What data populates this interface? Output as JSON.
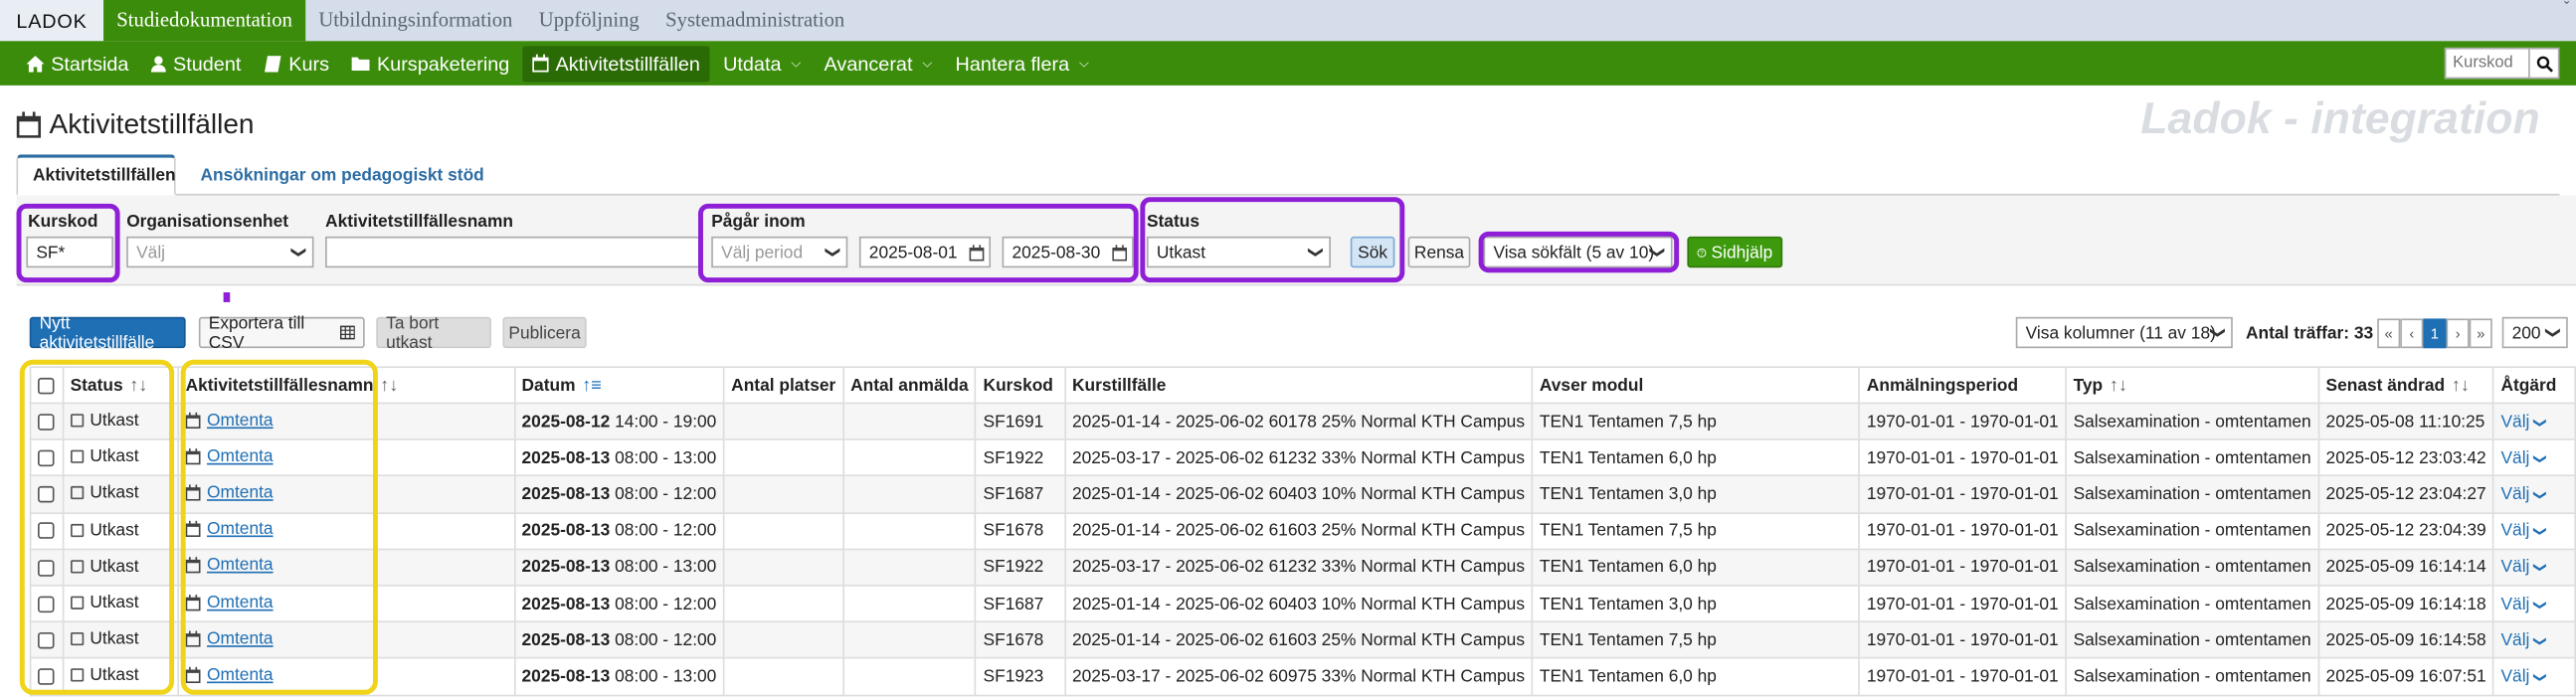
{
  "top": {
    "logo": "LADOK",
    "tabs": [
      "Studiedokumentation",
      "Utbildningsinformation",
      "Uppföljning",
      "Systemadministration"
    ],
    "corner": "ˇ"
  },
  "nav": {
    "items": [
      {
        "label": "Startsida",
        "icon": "home-icon"
      },
      {
        "label": "Student",
        "icon": "user-icon"
      },
      {
        "label": "Kurs",
        "icon": "book-icon"
      },
      {
        "label": "Kurspaketering",
        "icon": "folder-icon"
      },
      {
        "label": "Aktivitetstillfällen",
        "icon": "calendar-icon"
      },
      {
        "label": "Utdata",
        "dropdown": true
      },
      {
        "label": "Avancerat",
        "dropdown": true
      },
      {
        "label": "Hantera flera",
        "dropdown": true
      }
    ],
    "search_placeholder": "Kurskod"
  },
  "page": {
    "title": "Aktivitetstillfällen",
    "watermark": "Ladok - integration"
  },
  "tabs": [
    "Aktivitetstillfällen",
    "Ansökningar om pedagogiskt stöd"
  ],
  "filters": {
    "kurskod_label": "Kurskod",
    "kurskod_value": "SF*",
    "org_label": "Organisationsenhet",
    "org_placeholder": "Välj",
    "name_label": "Aktivitetstillfällesnamn",
    "name_value": "",
    "period_label": "Pågår inom",
    "period_placeholder": "Välj period",
    "date_from": "2025-08-01",
    "date_to": "2025-08-30",
    "status_label": "Status",
    "status_value": "Utkast",
    "search_button": "Sök",
    "clear_button": "Rensa",
    "show_fields": "Visa sökfält (5 av 10)",
    "help_button": "Sidhjälp"
  },
  "toolbar": {
    "new_button": "Nytt aktivitetstillfälle",
    "export_button": "Exportera till CSV",
    "delete_button": "Ta bort utkast",
    "publish_button": "Publicera",
    "columns_select": "Visa kolumner (11 av 18)",
    "hits_label": "Antal träffar: 33",
    "pages": [
      "«",
      "‹",
      "1",
      "›",
      "»"
    ],
    "page_size": "200"
  },
  "table": {
    "headers": [
      "Status",
      "Aktivitetstillfällesnamn",
      "Datum",
      "Antal platser",
      "Antal anmälda",
      "Kurskod",
      "Kurstillfälle",
      "Avser modul",
      "Anmälningsperiod",
      "Typ",
      "Senast ändrad",
      "Åtgärd"
    ],
    "rows": [
      {
        "status": "Utkast",
        "name": "Omtenta",
        "date": "2025-08-12",
        "time": "14:00 - 19:00",
        "platser": "",
        "anmalda": "",
        "kurskod": "SF1691",
        "tillfalle": "2025-01-14 - 2025-06-02 60178 25% Normal KTH Campus",
        "modul": "TEN1 Tentamen 7,5 hp",
        "period": "1970-01-01 - 1970-01-01",
        "typ": "Salsexamination - omtentamen",
        "andrad": "2025-05-08 11:10:25",
        "action": "Välj"
      },
      {
        "status": "Utkast",
        "name": "Omtenta",
        "date": "2025-08-13",
        "time": "08:00 - 13:00",
        "platser": "",
        "anmalda": "",
        "kurskod": "SF1922",
        "tillfalle": "2025-03-17 - 2025-06-02 61232 33% Normal KTH Campus",
        "modul": "TEN1 Tentamen 6,0 hp",
        "period": "1970-01-01 - 1970-01-01",
        "typ": "Salsexamination - omtentamen",
        "andrad": "2025-05-12 23:03:42",
        "action": "Välj"
      },
      {
        "status": "Utkast",
        "name": "Omtenta",
        "date": "2025-08-13",
        "time": "08:00 - 12:00",
        "platser": "",
        "anmalda": "",
        "kurskod": "SF1687",
        "tillfalle": "2025-01-14 - 2025-06-02 60403 10% Normal KTH Campus",
        "modul": "TEN1 Tentamen 3,0 hp",
        "period": "1970-01-01 - 1970-01-01",
        "typ": "Salsexamination - omtentamen",
        "andrad": "2025-05-12 23:04:27",
        "action": "Välj"
      },
      {
        "status": "Utkast",
        "name": "Omtenta",
        "date": "2025-08-13",
        "time": "08:00 - 12:00",
        "platser": "",
        "anmalda": "",
        "kurskod": "SF1678",
        "tillfalle": "2025-01-14 - 2025-06-02 61603 25% Normal KTH Campus",
        "modul": "TEN1 Tentamen 7,5 hp",
        "period": "1970-01-01 - 1970-01-01",
        "typ": "Salsexamination - omtentamen",
        "andrad": "2025-05-12 23:04:39",
        "action": "Välj"
      },
      {
        "status": "Utkast",
        "name": "Omtenta",
        "date": "2025-08-13",
        "time": "08:00 - 13:00",
        "platser": "",
        "anmalda": "",
        "kurskod": "SF1922",
        "tillfalle": "2025-03-17 - 2025-06-02 61232 33% Normal KTH Campus",
        "modul": "TEN1 Tentamen 6,0 hp",
        "period": "1970-01-01 - 1970-01-01",
        "typ": "Salsexamination - omtentamen",
        "andrad": "2025-05-09 16:14:14",
        "action": "Välj"
      },
      {
        "status": "Utkast",
        "name": "Omtenta",
        "date": "2025-08-13",
        "time": "08:00 - 12:00",
        "platser": "",
        "anmalda": "",
        "kurskod": "SF1687",
        "tillfalle": "2025-01-14 - 2025-06-02 60403 10% Normal KTH Campus",
        "modul": "TEN1 Tentamen 3,0 hp",
        "period": "1970-01-01 - 1970-01-01",
        "typ": "Salsexamination - omtentamen",
        "andrad": "2025-05-09 16:14:18",
        "action": "Välj"
      },
      {
        "status": "Utkast",
        "name": "Omtenta",
        "date": "2025-08-13",
        "time": "08:00 - 12:00",
        "platser": "",
        "anmalda": "",
        "kurskod": "SF1678",
        "tillfalle": "2025-01-14 - 2025-06-02 61603 25% Normal KTH Campus",
        "modul": "TEN1 Tentamen 7,5 hp",
        "period": "1970-01-01 - 1970-01-01",
        "typ": "Salsexamination - omtentamen",
        "andrad": "2025-05-09 16:14:58",
        "action": "Välj"
      },
      {
        "status": "Utkast",
        "name": "Omtenta",
        "date": "2025-08-13",
        "time": "08:00 - 13:00",
        "platser": "",
        "anmalda": "",
        "kurskod": "SF1923",
        "tillfalle": "2025-03-17 - 2025-06-02 60975 33% Normal KTH Campus",
        "modul": "TEN1 Tentamen 6,0 hp",
        "period": "1970-01-01 - 1970-01-01",
        "typ": "Salsexamination - omtentamen",
        "andrad": "2025-05-09 16:07:51",
        "action": "Välj"
      }
    ]
  }
}
